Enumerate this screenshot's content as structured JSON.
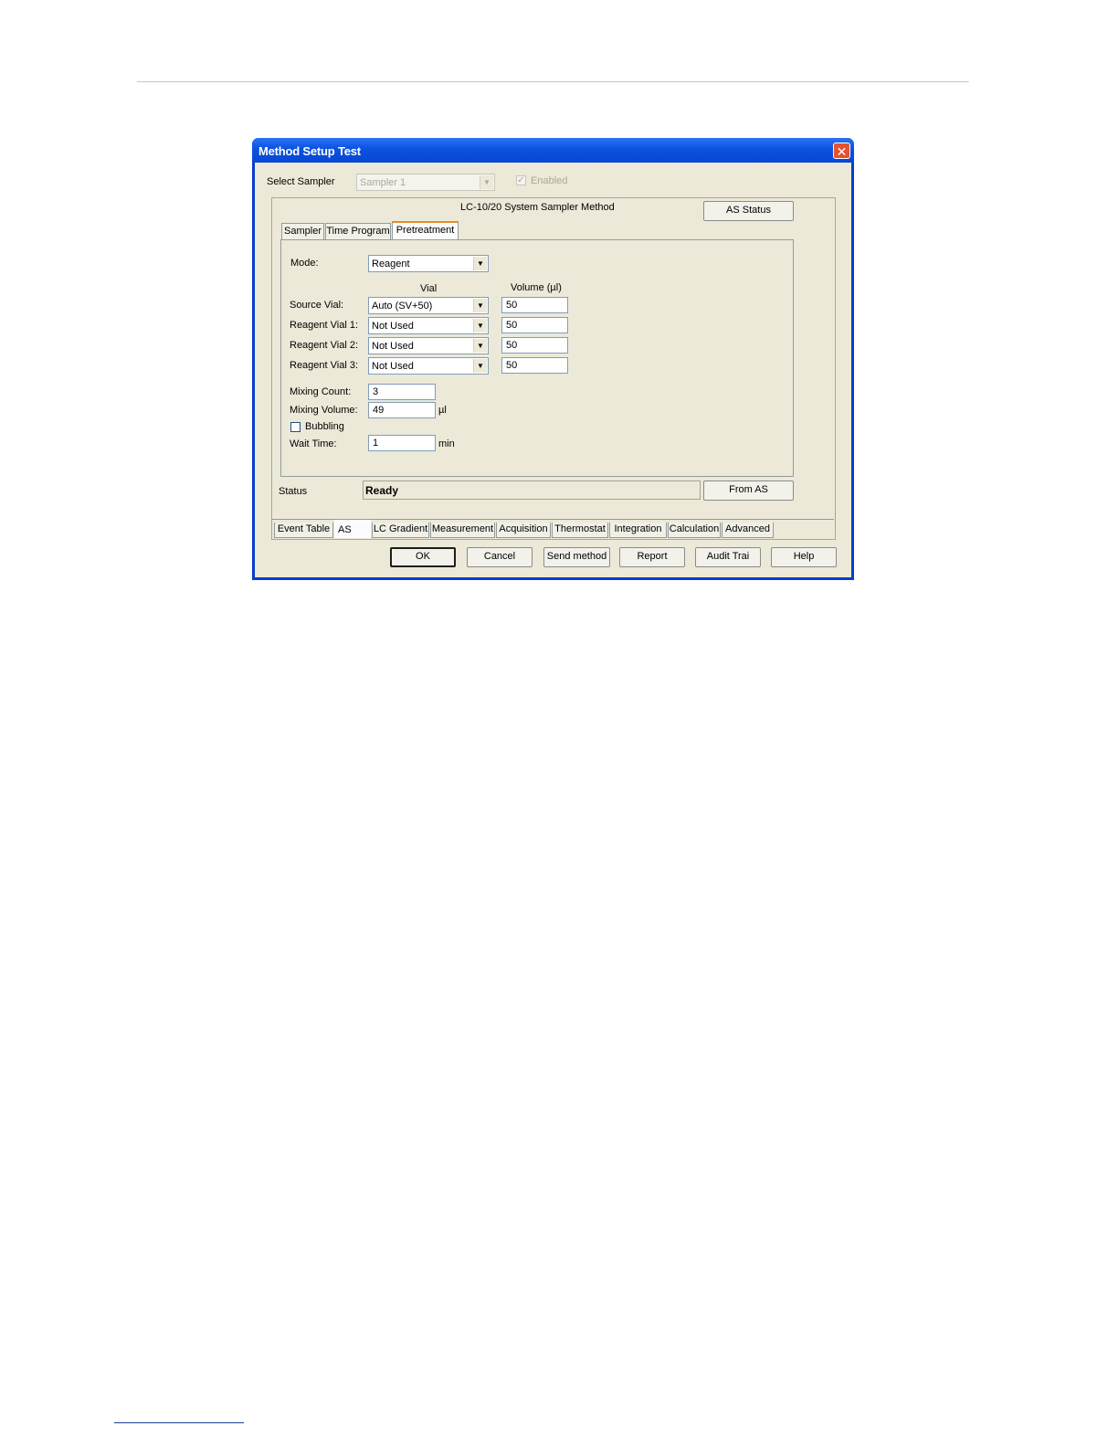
{
  "window": {
    "title": "Method Setup Test"
  },
  "sampler_select": {
    "label": "Select Sampler",
    "value": "Sampler 1",
    "enabled_label": "Enabled"
  },
  "group": {
    "title": "LC-10/20 System Sampler Method",
    "as_status": "AS Status"
  },
  "tabs": [
    "Sampler",
    "Time Program",
    "Pretreatment"
  ],
  "form": {
    "mode_label": "Mode:",
    "mode_value": "Reagent",
    "col_vial": "Vial",
    "col_volume": "Volume (µl)",
    "rows": [
      {
        "label": "Source Vial:",
        "vial": "Auto (SV+50)",
        "volume": "50"
      },
      {
        "label": "Reagent Vial 1:",
        "vial": "Not Used",
        "volume": "50"
      },
      {
        "label": "Reagent Vial 2:",
        "vial": "Not Used",
        "volume": "50"
      },
      {
        "label": "Reagent Vial 3:",
        "vial": "Not Used",
        "volume": "50"
      }
    ],
    "mixing_count_label": "Mixing Count:",
    "mixing_count": "3",
    "mixing_volume_label": "Mixing Volume:",
    "mixing_volume": "49",
    "mixing_volume_unit": "µl",
    "bubbling_label": "Bubbling",
    "wait_time_label": "Wait Time:",
    "wait_time": "1",
    "wait_time_unit": "min"
  },
  "status": {
    "label": "Status",
    "value": "Ready",
    "from_as": "From AS"
  },
  "bottom_tabs": [
    "Event Table",
    "AS",
    "LC Gradient",
    "Measurement",
    "Acquisition",
    "Thermostat",
    "Integration",
    "Calculation",
    "Advanced"
  ],
  "buttons": [
    "OK",
    "Cancel",
    "Send method",
    "Report",
    "Audit Trai",
    "Help"
  ],
  "colors": {
    "title_bar": "#0a52e0",
    "dialog_bg": "#ece9d8",
    "close": "#e4522f",
    "active_tab_accent": "#e68b2c"
  }
}
